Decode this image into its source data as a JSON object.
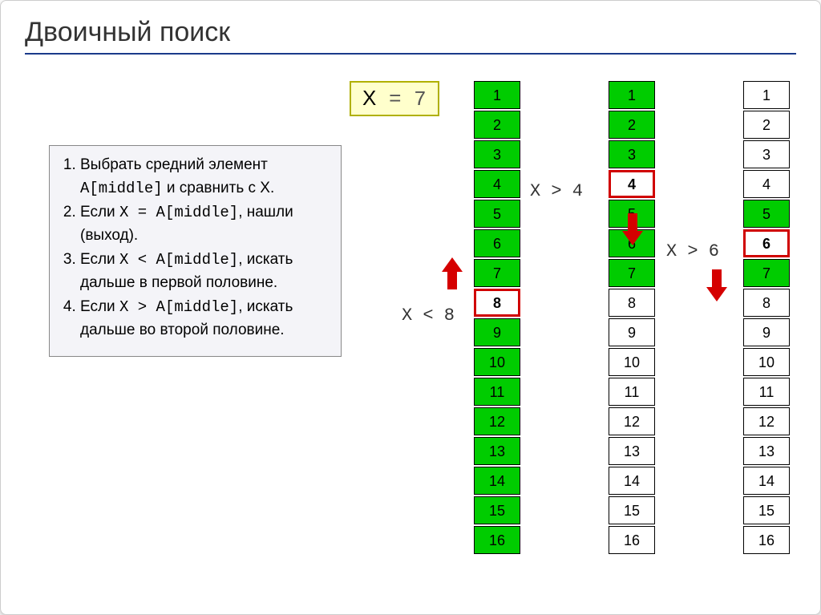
{
  "title": "Двоичный поиск",
  "x_expr": {
    "x": "X",
    "eq": " = ",
    "val": "7"
  },
  "algorithm": {
    "items": [
      {
        "pre": "Выбрать средний элемент ",
        "code": "A[middle]",
        "post": " и сравнить с X."
      },
      {
        "pre": "Если ",
        "code": "X = A[middle]",
        "post": ", нашли (выход)."
      },
      {
        "pre": "Если ",
        "code": "X < A[middle]",
        "post": ", искать дальше в первой половине."
      },
      {
        "pre": "Если ",
        "code": "X > A[middle]",
        "post": ", искать дальше во второй половине."
      }
    ]
  },
  "labels": {
    "lt8": "X < 8",
    "gt4": "X > 4",
    "gt6": "X > 6"
  },
  "columns": [
    {
      "cells": [
        {
          "v": "1",
          "c": "green"
        },
        {
          "v": "2",
          "c": "green"
        },
        {
          "v": "3",
          "c": "green"
        },
        {
          "v": "4",
          "c": "green"
        },
        {
          "v": "5",
          "c": "green"
        },
        {
          "v": "6",
          "c": "green"
        },
        {
          "v": "7",
          "c": "green"
        },
        {
          "v": "8",
          "c": "white",
          "hl": true
        },
        {
          "v": "9",
          "c": "green"
        },
        {
          "v": "10",
          "c": "green"
        },
        {
          "v": "11",
          "c": "green"
        },
        {
          "v": "12",
          "c": "green"
        },
        {
          "v": "13",
          "c": "green"
        },
        {
          "v": "14",
          "c": "green"
        },
        {
          "v": "15",
          "c": "green"
        },
        {
          "v": "16",
          "c": "green"
        }
      ]
    },
    {
      "cells": [
        {
          "v": "1",
          "c": "green"
        },
        {
          "v": "2",
          "c": "green"
        },
        {
          "v": "3",
          "c": "green"
        },
        {
          "v": "4",
          "c": "white",
          "hl": true
        },
        {
          "v": "5",
          "c": "green"
        },
        {
          "v": "6",
          "c": "green"
        },
        {
          "v": "7",
          "c": "green"
        },
        {
          "v": "8",
          "c": "white"
        },
        {
          "v": "9",
          "c": "white"
        },
        {
          "v": "10",
          "c": "white"
        },
        {
          "v": "11",
          "c": "white"
        },
        {
          "v": "12",
          "c": "white"
        },
        {
          "v": "13",
          "c": "white"
        },
        {
          "v": "14",
          "c": "white"
        },
        {
          "v": "15",
          "c": "white"
        },
        {
          "v": "16",
          "c": "white"
        }
      ]
    },
    {
      "cells": [
        {
          "v": "1",
          "c": "white"
        },
        {
          "v": "2",
          "c": "white"
        },
        {
          "v": "3",
          "c": "white"
        },
        {
          "v": "4",
          "c": "white"
        },
        {
          "v": "5",
          "c": "green"
        },
        {
          "v": "6",
          "c": "white",
          "hl": true
        },
        {
          "v": "7",
          "c": "green"
        },
        {
          "v": "8",
          "c": "white"
        },
        {
          "v": "9",
          "c": "white"
        },
        {
          "v": "10",
          "c": "white"
        },
        {
          "v": "11",
          "c": "white"
        },
        {
          "v": "12",
          "c": "white"
        },
        {
          "v": "13",
          "c": "white"
        },
        {
          "v": "14",
          "c": "white"
        },
        {
          "v": "15",
          "c": "white"
        },
        {
          "v": "16",
          "c": "white"
        }
      ]
    }
  ]
}
